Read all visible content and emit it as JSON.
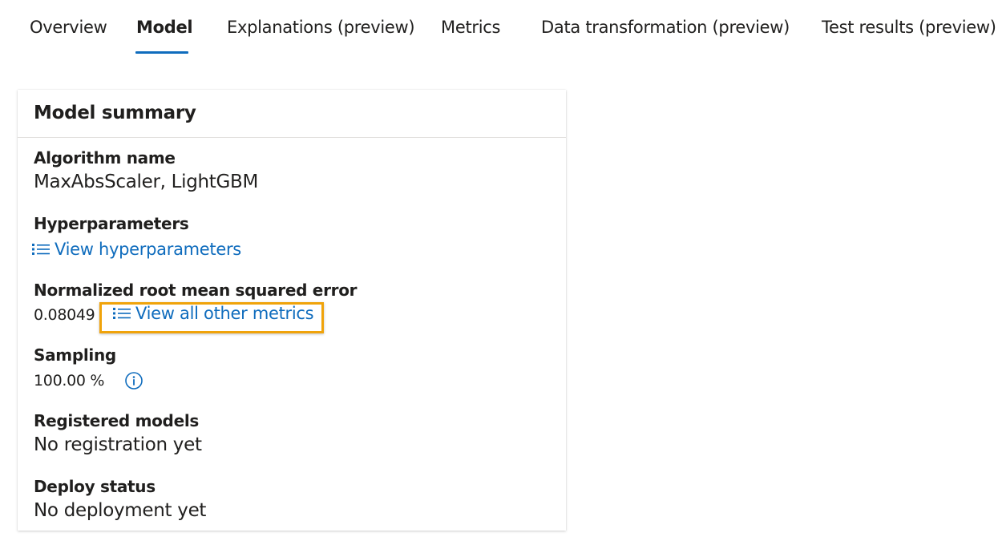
{
  "tabs": [
    {
      "label": "Overview"
    },
    {
      "label": "Model"
    },
    {
      "label": "Explanations (preview)"
    },
    {
      "label": "Metrics"
    },
    {
      "label": "Data transformation (preview)"
    },
    {
      "label": "Test results (preview)"
    }
  ],
  "active_tab": "Model",
  "card": {
    "title": "Model summary",
    "algorithm": {
      "label": "Algorithm name",
      "value": "MaxAbsScaler, LightGBM"
    },
    "hyperparameters": {
      "label": "Hyperparameters",
      "link": "View hyperparameters",
      "icon": "list-icon"
    },
    "metric": {
      "label": "Normalized root mean squared error",
      "value": "0.08049",
      "link": "View all other metrics",
      "icon": "list-icon"
    },
    "sampling": {
      "label": "Sampling",
      "value": "100.00 %",
      "icon": "info-icon"
    },
    "registered": {
      "label": "Registered models",
      "value": "No registration yet"
    },
    "deploy": {
      "label": "Deploy status",
      "value": "No deployment yet"
    }
  },
  "colors": {
    "accent": "#0f6cbd",
    "highlight": "#f0a30a",
    "text": "#201f1e",
    "divider": "#e1dfdd"
  }
}
